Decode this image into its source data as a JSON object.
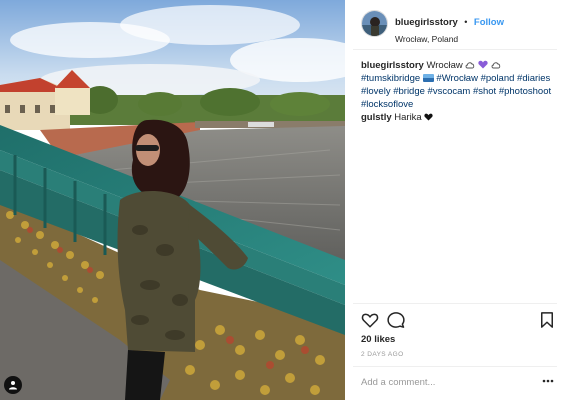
{
  "post": {
    "photo_icon": "photo-of-woman-on-love-lock-bridge-over-river",
    "tag_icon": "person-tag-icon"
  },
  "header": {
    "username": "bluegirlsstory",
    "separator": "•",
    "follow_label": "Follow",
    "location": "Wrocław, Poland",
    "avatar_icon": "profile-avatar"
  },
  "caption": {
    "username": "bluegirlsstory",
    "text_start": "Wrocław",
    "tumski_tag": "#tumskibridge",
    "hashtags": "#Wrocław #poland #diaries #lovely #bridge #vscocam #shot #photoshoot #locksoflove",
    "icons": [
      "cloud-icon",
      "purple-heart-icon",
      "cloud-icon",
      "flag-emoji-icon"
    ]
  },
  "comment": {
    "username": "gulstly",
    "text": "Harika",
    "icon": "black-heart-icon"
  },
  "actions": {
    "like_icon": "heart-outline-icon",
    "comment_icon": "speech-bubble-icon",
    "save_icon": "bookmark-icon"
  },
  "likes_label": "20 likes",
  "timestamp": "2 DAYS AGO",
  "add_comment": {
    "placeholder": "Add a comment...",
    "more_icon": "more-options-icon"
  },
  "colors": {
    "link_blue": "#3897f0",
    "hashtag": "#003569",
    "text": "#262626",
    "muted": "#999999",
    "divider": "#efefef"
  }
}
